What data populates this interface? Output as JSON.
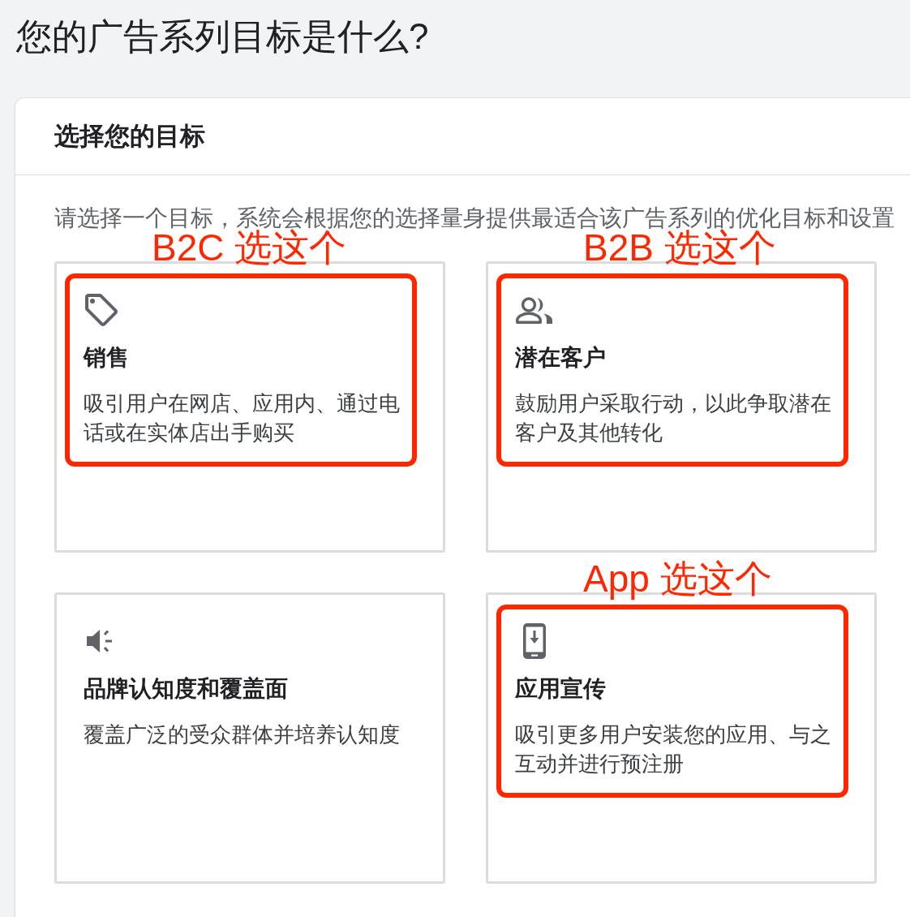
{
  "page": {
    "title": "您的广告系列目标是什么?"
  },
  "panel": {
    "title": "选择您的目标",
    "description": "请选择一个目标，系统会根据您的选择量身提供最适合该广告系列的优化目标和设置"
  },
  "goals": [
    {
      "kind": "tag",
      "title": "销售",
      "description": "吸引用户在网店、应用内、通过电话或在实体店出手购买",
      "highlighted": true
    },
    {
      "kind": "people",
      "title": "潜在客户",
      "description": "鼓励用户采取行动，以此争取潜在客户及其他转化",
      "highlighted": true
    },
    {
      "kind": "speaker",
      "title": "品牌认知度和覆盖面",
      "description": "覆盖广泛的受众群体并培养认知度",
      "highlighted": false
    },
    {
      "kind": "phone",
      "title": "应用宣传",
      "description": "吸引更多用户安装您的应用、与之互动并进行预注册",
      "highlighted": true
    }
  ],
  "annotations": [
    {
      "label": "B2C 选这个"
    },
    {
      "label": "B2B 选这个"
    },
    {
      "label": "App 选这个"
    }
  ]
}
